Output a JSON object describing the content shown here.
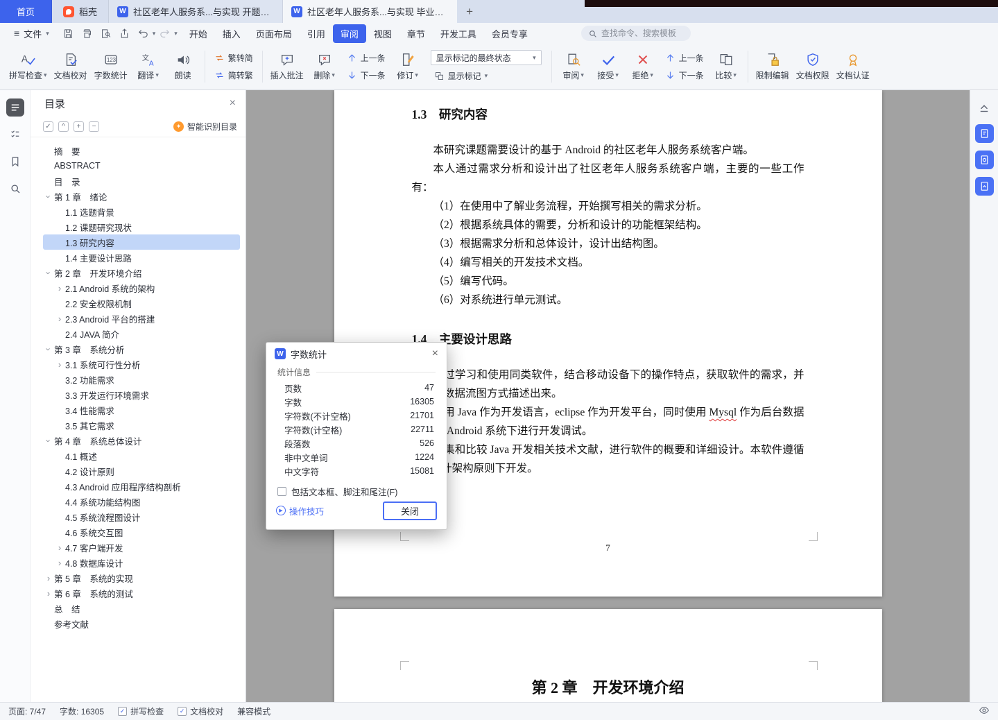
{
  "icons": {
    "caret": "▾",
    "chevron": "›",
    "close": "×",
    "plus": "+",
    "minus": "−",
    "check": "✓",
    "collapse_caret": "^",
    "new_tab": "+",
    "hamburger": "≡",
    "play": "▶",
    "w_logo": "W",
    "sparkle": "✦"
  },
  "colors": {
    "accent_blue": "#3d63ec",
    "toc_selection": "#c2d6f8",
    "canvas_grey": "#a2a2a2",
    "docer_orange": "#ff5531",
    "spell_error_red": "#e03c3c"
  },
  "tabbar": {
    "home": "首页",
    "docer": "稻壳",
    "documents": [
      "社区老年人服务系...与实现 开题报告",
      "社区老年人服务系...与实现 毕业论文"
    ]
  },
  "menubar": {
    "file": "文件",
    "items": [
      "开始",
      "插入",
      "页面布局",
      "引用",
      "审阅",
      "视图",
      "章节",
      "开发工具",
      "会员专享"
    ],
    "search_placeholder": "查找命令、搜索模板"
  },
  "ribbon": {
    "spell_check": "拼写检查",
    "doc_proof": "文档校对",
    "word_count": "字数统计",
    "translate": "翻译",
    "read_aloud": "朗读",
    "trad_to_simp": "繁转简",
    "simp_to_trad": "简转繁",
    "insert_comment": "插入批注",
    "delete_comment": "删除",
    "prev_comment": "上一条",
    "next_comment": "下一条",
    "track_changes": "修订",
    "markup_state": "显示标记的最终状态",
    "show_markup": "显示标记",
    "review": "审阅",
    "accept": "接受",
    "reject": "拒绝",
    "prev_change": "上一条",
    "next_change": "下一条",
    "compare": "比较",
    "restrict_editing": "限制编辑",
    "doc_permission": "文档权限",
    "doc_certify": "文档认证"
  },
  "toc": {
    "title": "目录",
    "smart_recognize": "智能识别目录",
    "items": [
      {
        "label": "摘　要"
      },
      {
        "label": "ABSTRACT"
      },
      {
        "label": "目　录"
      },
      {
        "label": "第 1 章　绪论"
      },
      {
        "label": "1.1 选题背景"
      },
      {
        "label": "1.2 课题研究现状"
      },
      {
        "label": "1.3 研究内容"
      },
      {
        "label": "1.4 主要设计思路"
      },
      {
        "label": "第 2 章　开发环境介绍"
      },
      {
        "label": "2.1 Android 系统的架构"
      },
      {
        "label": "2.2 安全权限机制"
      },
      {
        "label": "2.3 Android 平台的搭建"
      },
      {
        "label": "2.4 JAVA 简介"
      },
      {
        "label": "第 3 章　系统分析"
      },
      {
        "label": "3.1 系统可行性分析"
      },
      {
        "label": "3.2 功能需求"
      },
      {
        "label": "3.3 开发运行环境需求"
      },
      {
        "label": "3.4 性能需求"
      },
      {
        "label": "3.5 其它需求"
      },
      {
        "label": "第 4 章　系统总体设计"
      },
      {
        "label": "4.1 概述"
      },
      {
        "label": "4.2 设计原则"
      },
      {
        "label": "4.3 Android 应用程序结构剖析"
      },
      {
        "label": "4.4 系统功能结构图"
      },
      {
        "label": "4.5 系统流程图设计"
      },
      {
        "label": "4.6 系统交互图"
      },
      {
        "label": "4.7 客户端开发"
      },
      {
        "label": "4.8 数据库设计"
      },
      {
        "label": "第 5 章　系统的实现"
      },
      {
        "label": "第 6 章　系统的测试"
      },
      {
        "label": "总　结"
      },
      {
        "label": "参考文献"
      }
    ]
  },
  "doc": {
    "page7": {
      "h13": "1.3　研究内容",
      "p1": "本研究课题需要设计的基于 Android 的社区老年人服务系统客户端。",
      "p2": "本人通过需求分析和设计出了社区老年人服务系统客户端，主要的一些工作有：",
      "items": [
        "（1）在使用中了解业务流程，开始撰写相关的需求分析。",
        "（2）根据系统具体的需要，分析和设计的功能框架结构。",
        "（3）根据需求分析和总体设计，设计出结构图。",
        "（4）编写相关的开发技术文档。",
        "（5）编写代码。",
        "（6）对系统进行单元测试。"
      ],
      "h14": "1.4　主要设计思路",
      "p3": "通过学习和使用同类软件，结合移动设备下的操作特点，获取软件的需求，并将其用数据流图方式描述出来。",
      "p4_before": "使用 Java 作为开发语言，eclipse 作为开发平台，同时使用 ",
      "p4_misspelled": "Mysql",
      "p4_after": " 作为后台数据库，在 Android 系统下进行开发调试。",
      "p5": "搜集和比较 Java 开发相关技术文献，进行软件的概要和详细设计。本软件遵循 C/S 设计架构原则下开发。",
      "page_number": "7"
    },
    "page8": {
      "h2": "第 2 章　开发环境介绍"
    }
  },
  "dialog": {
    "title": "字数统计",
    "section": "统计信息",
    "stats": [
      {
        "label": "页数",
        "value": "47"
      },
      {
        "label": "字数",
        "value": "16305"
      },
      {
        "label": "字符数(不计空格)",
        "value": "21701"
      },
      {
        "label": "字符数(计空格)",
        "value": "22711"
      },
      {
        "label": "段落数",
        "value": "526"
      },
      {
        "label": "非中文单词",
        "value": "1224"
      },
      {
        "label": "中文字符",
        "value": "15081"
      }
    ],
    "include_checkbox": "包括文本框、脚注和尾注(F)",
    "tips": "操作技巧",
    "close": "关闭"
  },
  "statusbar": {
    "page": "页面: 7/47",
    "words": "字数: 16305",
    "spell": "拼写检查",
    "proof": "文档校对",
    "compat": "兼容模式"
  }
}
